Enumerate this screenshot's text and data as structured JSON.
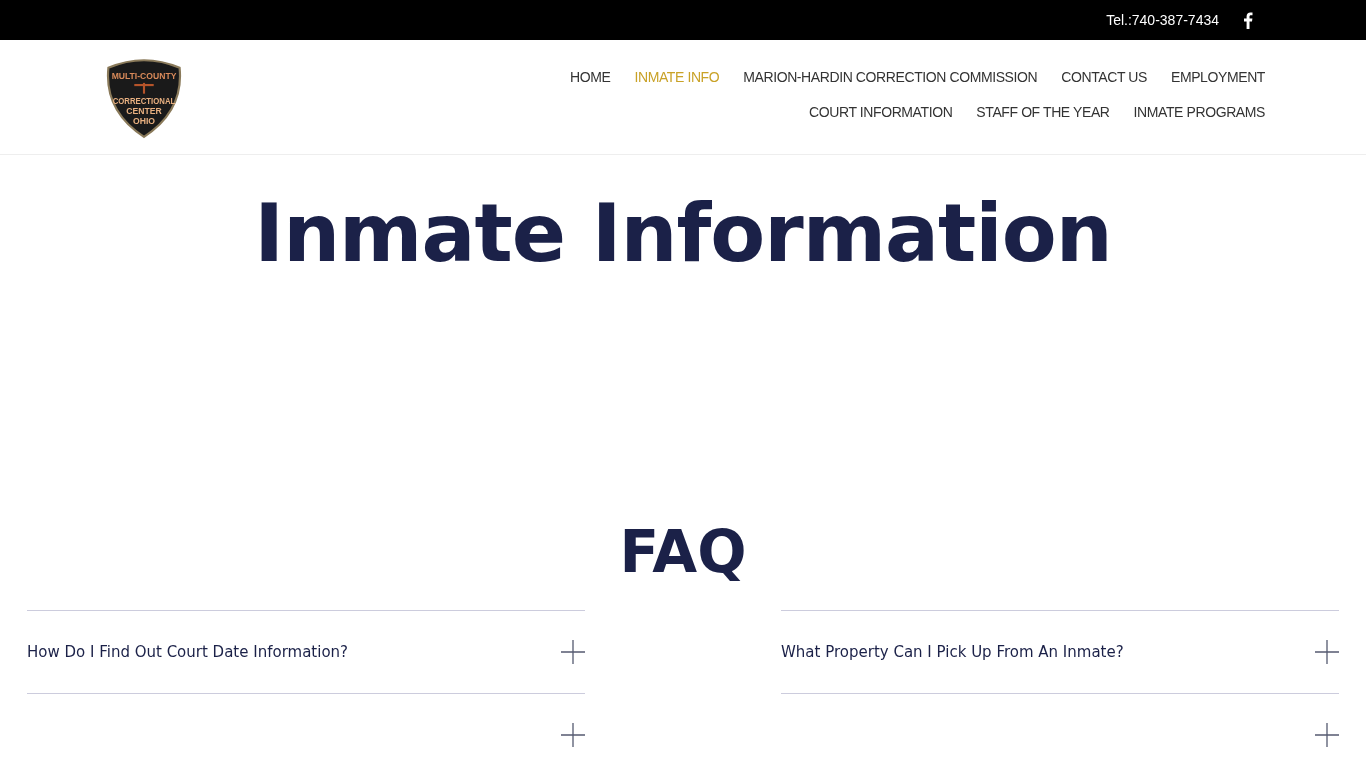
{
  "top_bar": {
    "phone": "Tel.:740-387-7434"
  },
  "logo": {
    "lines": [
      "MULTI-COUNTY",
      "CORRECTIONAL",
      "CENTER",
      "OHIO"
    ]
  },
  "nav": {
    "items": [
      {
        "label": "HOME",
        "selected": false
      },
      {
        "label": "INMATE INFO",
        "selected": true
      },
      {
        "label": "MARION-HARDIN CORRECTION COMMISSION",
        "selected": false
      },
      {
        "label": "CONTACT US",
        "selected": false
      },
      {
        "label": "EMPLOYMENT",
        "selected": false
      },
      {
        "label": "COURT INFORMATION",
        "selected": false
      },
      {
        "label": "STAFF OF THE YEAR",
        "selected": false
      },
      {
        "label": "INMATE PROGRAMS",
        "selected": false
      }
    ]
  },
  "page_title": "Inmate Information",
  "faq": {
    "heading": "FAQ",
    "columns": [
      [
        {
          "question": "How Do I Find Out Court Date Information?"
        },
        {}
      ],
      [
        {
          "question": "What Property Can I Pick Up From An Inmate?"
        },
        {}
      ]
    ]
  }
}
